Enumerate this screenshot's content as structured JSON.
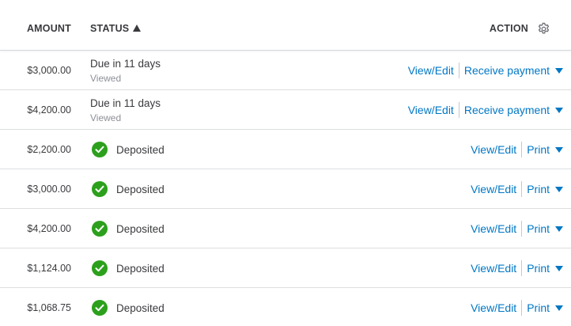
{
  "header": {
    "amount": "AMOUNT",
    "status": "STATUS",
    "action": "ACTION"
  },
  "colors": {
    "link": "#0077c5",
    "success": "#2ca01c",
    "text": "#393a3d",
    "muted": "#8d9096"
  },
  "rows": [
    {
      "amount": "$3,000.00",
      "status": "Due in 11 days",
      "sub": "Viewed",
      "action1": "View/Edit",
      "action2": "Receive payment"
    },
    {
      "amount": "$4,200.00",
      "status": "Due in 11 days",
      "sub": "Viewed",
      "action1": "View/Edit",
      "action2": "Receive payment"
    },
    {
      "amount": "$2,200.00",
      "status": "Deposited",
      "action1": "View/Edit",
      "action2": "Print"
    },
    {
      "amount": "$3,000.00",
      "status": "Deposited",
      "action1": "View/Edit",
      "action2": "Print"
    },
    {
      "amount": "$4,200.00",
      "status": "Deposited",
      "action1": "View/Edit",
      "action2": "Print"
    },
    {
      "amount": "$1,124.00",
      "status": "Deposited",
      "action1": "View/Edit",
      "action2": "Print"
    },
    {
      "amount": "$1,068.75",
      "status": "Deposited",
      "action1": "View/Edit",
      "action2": "Print"
    }
  ]
}
